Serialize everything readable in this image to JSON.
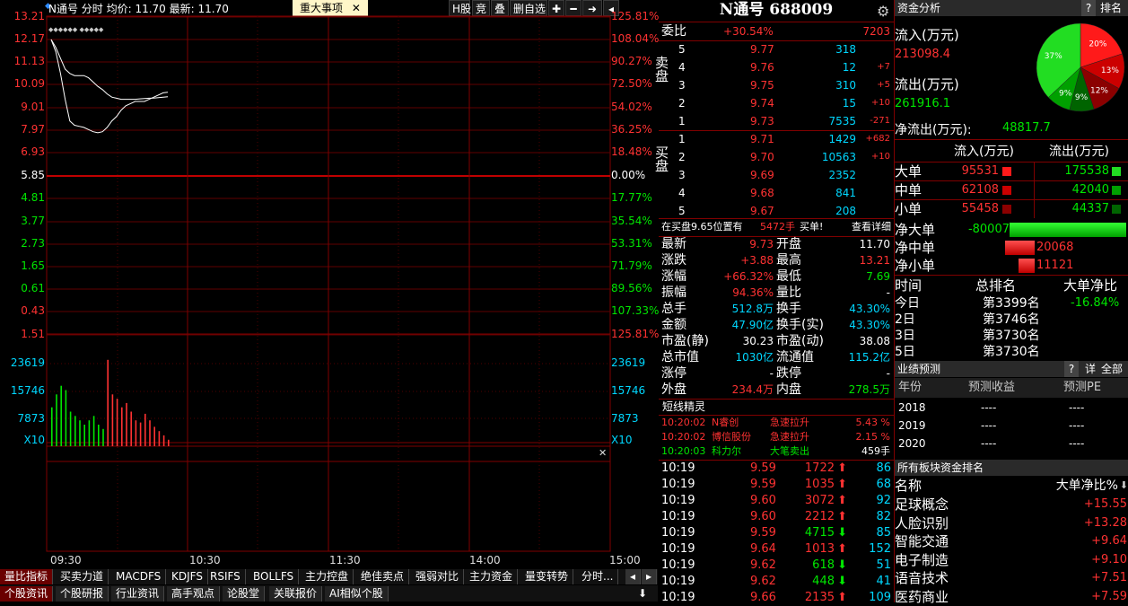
{
  "top": {
    "info": "N通号 分时 均价: 11.70 最新: 11.70",
    "news_tab": "重大事项",
    "buttons": [
      "H股",
      "竞",
      "叠",
      "删自选"
    ]
  },
  "yaxis_left": [
    "13.21",
    "12.17",
    "11.13",
    "10.09",
    "9.01",
    "7.97",
    "6.93",
    "5.85",
    "4.81",
    "3.77",
    "2.73",
    "1.65",
    "0.61",
    "0.43",
    "1.51"
  ],
  "yaxis_right": [
    "125.81%",
    "108.04%",
    "90.27%",
    "72.50%",
    "54.02%",
    "36.25%",
    "18.48%",
    "0.00%",
    "17.77%",
    "35.54%",
    "53.31%",
    "71.79%",
    "89.56%",
    "107.33%",
    "125.81%"
  ],
  "vol_left": [
    "23619",
    "15746",
    "7873",
    "X10"
  ],
  "vol_right": [
    "23619",
    "15746",
    "7873",
    "X10"
  ],
  "times": [
    "09:30",
    "10:30",
    "11:30",
    "14:00",
    "15:00"
  ],
  "chart_data": {
    "type": "line",
    "price_series": [
      {
        "name": "price",
        "values": [
          12.17,
          11.6,
          10.6,
          9.4,
          8.4,
          8.2,
          8.15,
          8.1,
          8.0,
          7.9,
          7.85,
          7.9,
          8.1,
          8.4,
          8.6,
          8.9,
          9.1,
          9.2,
          9.3,
          9.3,
          9.3,
          9.4,
          9.5,
          9.6,
          9.7,
          9.73
        ]
      },
      {
        "name": "avg",
        "values": [
          12.17,
          11.8,
          11.3,
          10.8,
          10.6,
          10.5,
          10.5,
          10.5,
          10.4,
          10.2,
          10.0,
          9.85,
          9.65,
          9.5,
          9.45,
          9.4,
          9.4,
          9.4,
          9.4,
          9.42,
          9.44,
          9.45,
          9.46,
          9.48,
          9.5,
          9.52
        ]
      }
    ],
    "volumes": [
      9000,
      12000,
      14000,
      13000,
      8000,
      7000,
      6000,
      5000,
      6000,
      7000,
      5000,
      4000,
      20000,
      12000,
      11000,
      9000,
      10000,
      8000,
      6000,
      5500,
      7500,
      6000,
      4500,
      3500,
      2500,
      1500
    ]
  },
  "bottom_tabs1": [
    "量比指标",
    "买卖力道",
    "MACDFS",
    "KDJFS",
    "RSIFS",
    "BOLLFS",
    "主力控盘",
    "绝佳卖点",
    "强弱对比",
    "主力资金",
    "量变转势",
    "分时..."
  ],
  "bottom_tabs2": [
    "个股资讯",
    "个股研报",
    "行业资讯",
    "高手观点",
    "论股堂",
    "关联报价",
    "AI相似个股"
  ],
  "quote": {
    "title": "N通号  688009",
    "weibi_label": "委比",
    "weibi": "+30.54%",
    "weicha": "7203",
    "sell_label": "卖盘",
    "buy_label": "买盘",
    "sells": [
      {
        "n": "5",
        "p": "9.77",
        "v": "318",
        "d": ""
      },
      {
        "n": "4",
        "p": "9.76",
        "v": "12",
        "d": "+7"
      },
      {
        "n": "3",
        "p": "9.75",
        "v": "310",
        "d": "+5"
      },
      {
        "n": "2",
        "p": "9.74",
        "v": "15",
        "d": "+10"
      },
      {
        "n": "1",
        "p": "9.73",
        "v": "7535",
        "d": "-271"
      }
    ],
    "buys": [
      {
        "n": "1",
        "p": "9.71",
        "v": "1429",
        "d": "+682"
      },
      {
        "n": "2",
        "p": "9.70",
        "v": "10563",
        "d": "+10"
      },
      {
        "n": "3",
        "p": "9.69",
        "v": "2352",
        "d": ""
      },
      {
        "n": "4",
        "p": "9.68",
        "v": "841",
        "d": ""
      },
      {
        "n": "5",
        "p": "9.67",
        "v": "208",
        "d": ""
      }
    ],
    "notice_a": "在买盘9.65位置有",
    "notice_b": "5472手",
    "notice_c": "买单!",
    "notice_d": "查看详细",
    "stats": [
      [
        "最新",
        "9.73",
        "开盘",
        "11.70"
      ],
      [
        "涨跌",
        "+3.88",
        "最高",
        "13.21"
      ],
      [
        "涨幅",
        "+66.32%",
        "最低",
        "7.69"
      ],
      [
        "振幅",
        "94.36%",
        "量比",
        "-"
      ],
      [
        "总手",
        "512.8万",
        "换手",
        "43.30%"
      ],
      [
        "金额",
        "47.90亿",
        "换手(实)",
        "43.30%"
      ],
      [
        "市盈(静)",
        "30.23",
        "市盈(动)",
        "38.08"
      ],
      [
        "总市值",
        "1030亿",
        "流通值",
        "115.2亿"
      ],
      [
        "涨停",
        "-",
        "跌停",
        "-"
      ],
      [
        "外盘",
        "234.4万",
        "内盘",
        "278.5万"
      ]
    ],
    "short_title": "短线精灵",
    "short": [
      [
        "10:20:02",
        "N睿创",
        "急速拉升",
        "5.43 %"
      ],
      [
        "10:20:02",
        "博信股份",
        "急速拉升",
        "2.15 %"
      ],
      [
        "10:20:03",
        "科力尔",
        "大笔卖出",
        "459手"
      ]
    ],
    "ticks": [
      [
        "10:19",
        "9.59",
        "1722",
        "up",
        "86"
      ],
      [
        "10:19",
        "9.59",
        "1035",
        "up",
        "68"
      ],
      [
        "10:19",
        "9.60",
        "3072",
        "up",
        "92"
      ],
      [
        "10:19",
        "9.60",
        "2212",
        "up",
        "82"
      ],
      [
        "10:19",
        "9.59",
        "4715",
        "down",
        "85"
      ],
      [
        "10:19",
        "9.64",
        "1013",
        "up",
        "152"
      ],
      [
        "10:19",
        "9.62",
        "618",
        "down",
        "51"
      ],
      [
        "10:19",
        "9.62",
        "448",
        "down",
        "41"
      ],
      [
        "10:19",
        "9.66",
        "2135",
        "up",
        "109"
      ]
    ]
  },
  "fund": {
    "title": "资金分析",
    "rank": "排名",
    "help": "?",
    "in_label": "流入(万元)",
    "in_val": "213098.4",
    "out_label": "流出(万元)",
    "out_val": "261916.1",
    "net_label": "净流出(万元):",
    "net_val": "48817.7",
    "pie": [
      {
        "label": "20%",
        "value": 20,
        "color": "#ff1a1a"
      },
      {
        "label": "13%",
        "value": 13,
        "color": "#cc0000"
      },
      {
        "label": "12%",
        "value": 12,
        "color": "#8b0000"
      },
      {
        "label": "9%",
        "value": 9,
        "color": "#006400"
      },
      {
        "label": "9%",
        "value": 9,
        "color": "#00a000"
      },
      {
        "label": "37%",
        "value": 37,
        "color": "#22dd22"
      }
    ],
    "col_in": "流入(万元)",
    "col_out": "流出(万元)",
    "rows": [
      {
        "name": "大单",
        "in": "95531",
        "out": "175538"
      },
      {
        "name": "中单",
        "in": "62108",
        "out": "42040"
      },
      {
        "name": "小单",
        "in": "55458",
        "out": "44337"
      }
    ],
    "net": [
      {
        "name": "净大单",
        "val": "-80007",
        "frac": 1.0,
        "dir": "neg"
      },
      {
        "name": "净中单",
        "val": "20068",
        "frac": 0.25,
        "dir": "pos"
      },
      {
        "name": "净小单",
        "val": "11121",
        "frac": 0.14,
        "dir": "pos"
      }
    ],
    "rank_head": [
      "时间",
      "总排名",
      "大单净比"
    ],
    "ranks": [
      [
        "今日",
        "第3399名",
        "-16.84%"
      ],
      [
        "2日",
        "第3746名",
        ""
      ],
      [
        "3日",
        "第3730名",
        ""
      ],
      [
        "5日",
        "第3730名",
        ""
      ]
    ],
    "forecast_title": "业绩预测",
    "forecast_detail": "详",
    "forecast_all": "全部",
    "forecast_head": [
      "年份",
      "预测收益",
      "预测PE"
    ],
    "forecast": [
      [
        "2018",
        "----",
        "----"
      ],
      [
        "2019",
        "----",
        "----"
      ],
      [
        "2020",
        "----",
        "----"
      ]
    ],
    "sector_title": "所有板块资金排名",
    "sector_head": [
      "名称",
      "大单净比%"
    ],
    "sectors": [
      [
        "足球概念",
        "+15.55"
      ],
      [
        "人脸识别",
        "+13.28"
      ],
      [
        "智能交通",
        "+9.64"
      ],
      [
        "电子制造",
        "+9.10"
      ],
      [
        "语音技术",
        "+7.51"
      ],
      [
        "医药商业",
        "+7.59"
      ]
    ]
  }
}
